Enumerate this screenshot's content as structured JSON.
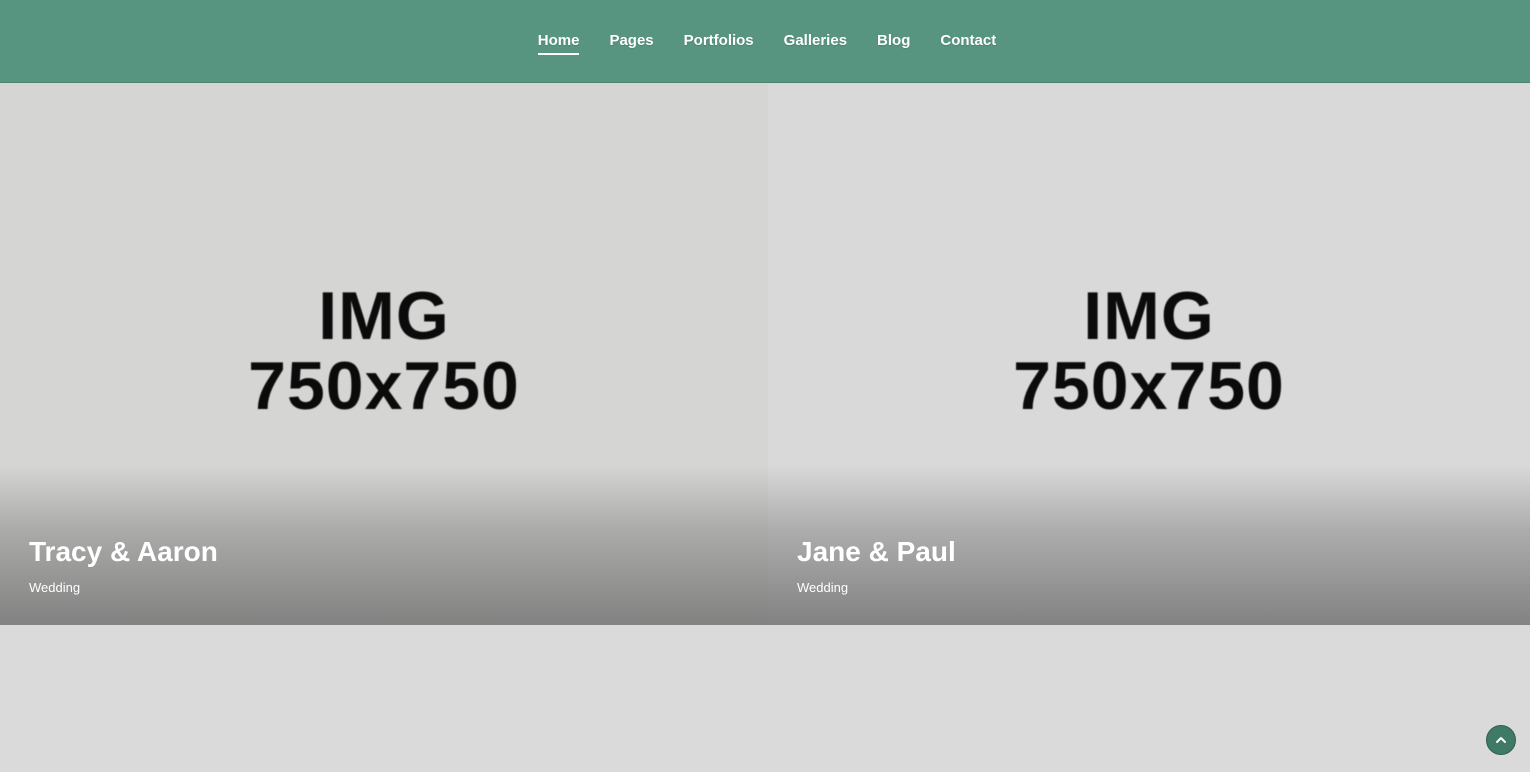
{
  "nav": {
    "items": [
      {
        "label": "Home"
      },
      {
        "label": "Pages"
      },
      {
        "label": "Portfolios"
      },
      {
        "label": "Galleries"
      },
      {
        "label": "Blog"
      },
      {
        "label": "Contact"
      }
    ],
    "active": "Home"
  },
  "gallery": {
    "cards": [
      {
        "image_line1": "IMG",
        "image_line2": "750x750",
        "title": "Tracy & Aaron",
        "category": "Wedding"
      },
      {
        "image_line1": "IMG",
        "image_line2": "750x750",
        "title": "Jane & Paul",
        "category": "Wedding"
      }
    ]
  },
  "icons": {
    "scroll_top": "chevron-up-icon"
  },
  "colors": {
    "header_bg": "#579580",
    "page_bg": "#dadada",
    "accent_dark": "#3f7a66"
  }
}
